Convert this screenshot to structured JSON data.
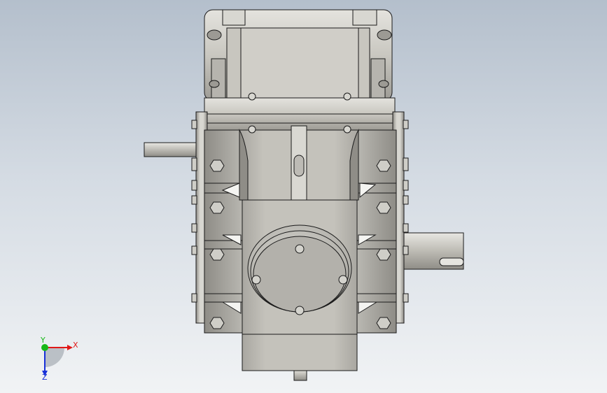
{
  "viewport": {
    "triad": {
      "x_label": "X",
      "y_label": "Y",
      "z_label": "Z"
    },
    "colors": {
      "metal_light": "#dcdbd6",
      "metal_mid": "#b8b6af",
      "metal_dark": "#8e8c86",
      "outline": "#1b1b1b",
      "x_axis": "#e01818",
      "y_axis": "#18b818",
      "z_axis": "#1830d8"
    }
  }
}
